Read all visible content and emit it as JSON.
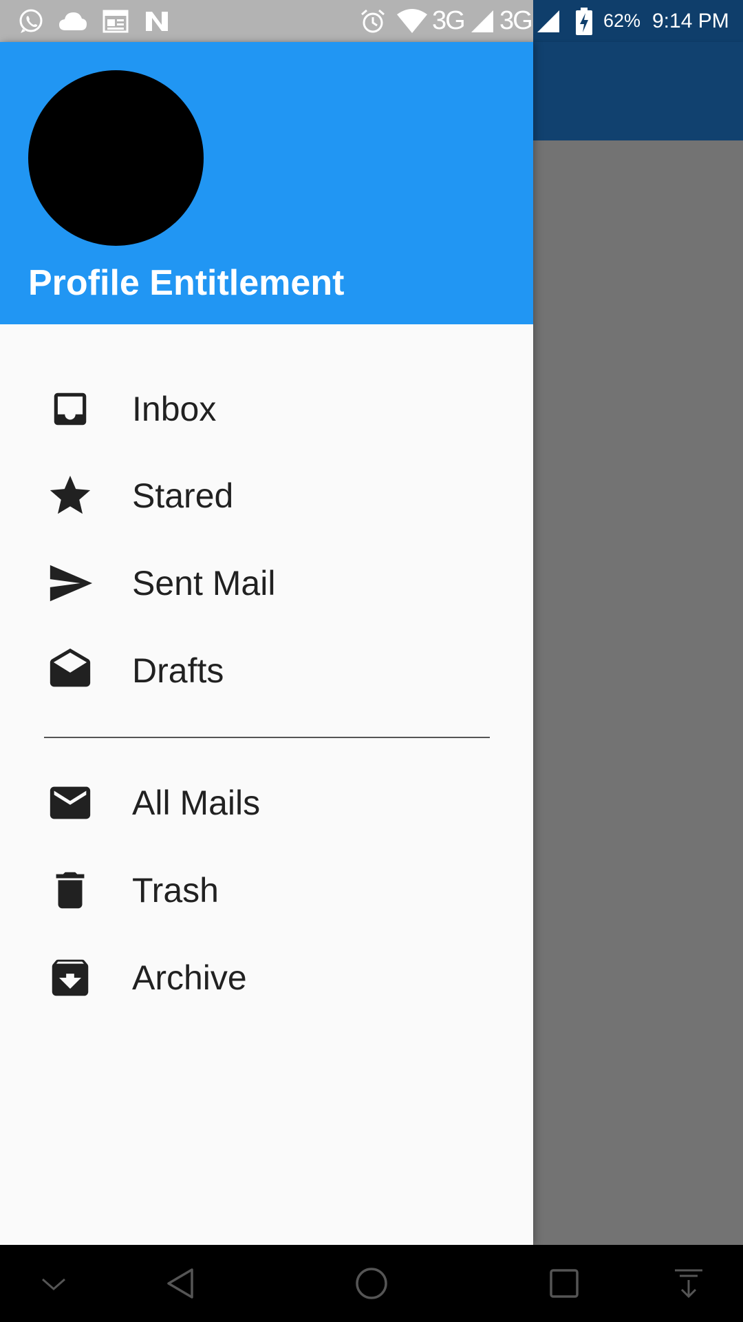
{
  "status_bar": {
    "battery_percent": "62%",
    "time": "9:14 PM",
    "network_1": "3G",
    "network_2": "3G",
    "notification_icons": [
      "whatsapp-icon",
      "cloud-icon",
      "news-icon",
      "n-app-icon"
    ],
    "system_icons": [
      "alarm-icon",
      "wifi-icon",
      "signal-icon",
      "battery-charging-icon"
    ]
  },
  "drawer": {
    "profile_name": "Profile Entitlement",
    "header_color": "#2196f3",
    "primary_items": [
      {
        "label": "Inbox",
        "icon": "inbox-icon"
      },
      {
        "label": "Stared",
        "icon": "star-icon"
      },
      {
        "label": "Sent Mail",
        "icon": "send-icon"
      },
      {
        "label": "Drafts",
        "icon": "drafts-icon"
      }
    ],
    "secondary_items": [
      {
        "label": "All Mails",
        "icon": "mail-icon"
      },
      {
        "label": "Trash",
        "icon": "trash-icon"
      },
      {
        "label": "Archive",
        "icon": "archive-icon"
      }
    ]
  },
  "app_bar": {
    "color": "#11416f"
  },
  "nav_bar": {
    "buttons": [
      "chevron-down-icon",
      "back-icon",
      "home-icon",
      "recents-icon",
      "notification-pull-icon"
    ]
  }
}
